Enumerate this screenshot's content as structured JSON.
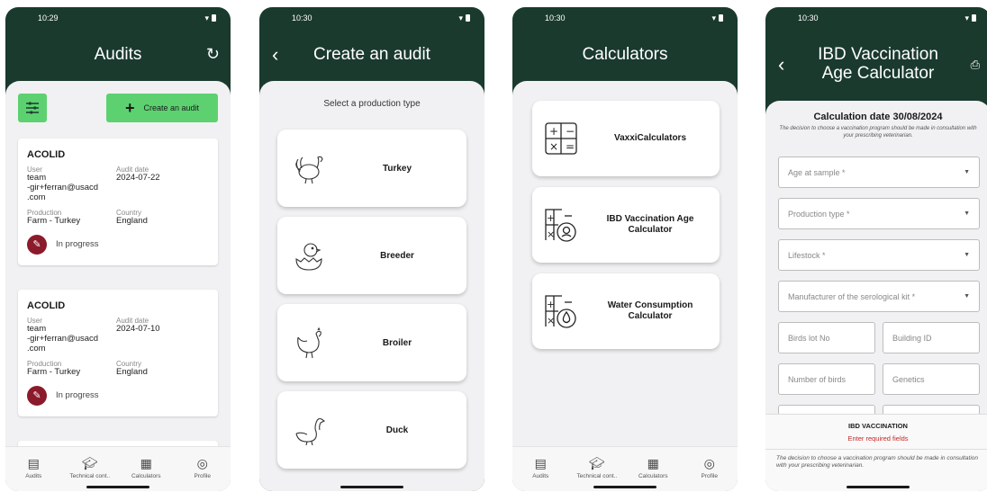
{
  "colors": {
    "header": "#1a3a2e",
    "accent": "#5dd170",
    "status_in_progress": "#8b1a2b",
    "warning": "#c62828"
  },
  "nav": {
    "audits": "Audits",
    "technical": "Technical cont..",
    "calculators": "Calculators",
    "profile": "Profile"
  },
  "screen1": {
    "time": "10:29",
    "title": "Audits",
    "create_label": "Create an audit",
    "audits": [
      {
        "name": "ACOLID",
        "user_label": "User",
        "user": "team\n-gir+ferran@usacd\n.com",
        "date_label": "Audit date",
        "date": "2024-07-22",
        "production_label": "Production",
        "production": "Farm - Turkey",
        "country_label": "Country",
        "country": "England",
        "status": "In progress"
      },
      {
        "name": "ACOLID",
        "user_label": "User",
        "user": "team\n-gir+ferran@usacd\n.com",
        "date_label": "Audit date",
        "date": "2024-07-10",
        "production_label": "Production",
        "production": "Farm - Turkey",
        "country_label": "Country",
        "country": "England",
        "status": "In progress"
      }
    ]
  },
  "screen2": {
    "time": "10:30",
    "title": "Create an audit",
    "subtitle": "Select a production type",
    "types": [
      "Turkey",
      "Breeder",
      "Broiler",
      "Duck"
    ]
  },
  "screen3": {
    "time": "10:30",
    "title": "Calculators",
    "items": [
      "VaxxiCalculators",
      "IBD Vaccination Age Calculator",
      "Water Consumption Calculator"
    ]
  },
  "screen4": {
    "time": "10:30",
    "title": "IBD Vaccination Age Calculator",
    "date_label": "Calculation date 30/08/2024",
    "note": "The decision to choose a vaccination program should be made in consultation with your prescribing veterinarian.",
    "fields": {
      "age": "Age at sample *",
      "production": "Production type *",
      "lifestock": "Lifestock *",
      "manufacturer": "Manufacturer of the serological kit *",
      "lot": "Birds lot No",
      "building": "Building ID",
      "number": "Number of birds",
      "genetics": "Genetics"
    },
    "result_title": "IBD VACCINATION",
    "result_warning": "Enter required fields",
    "result_note": "The decision to choose a vaccination program should be made in consultation with your prescribing veterinarian."
  }
}
